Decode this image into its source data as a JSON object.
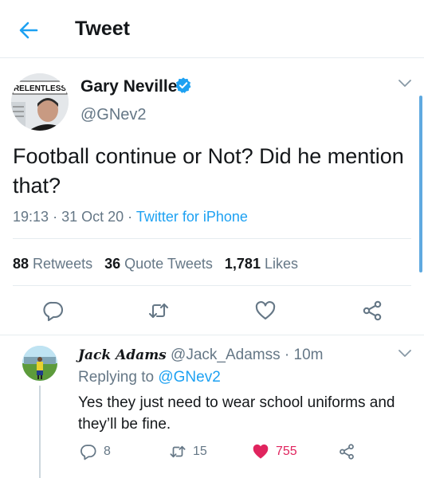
{
  "header": {
    "title": "Tweet"
  },
  "tweet": {
    "author_name": "Gary Neville",
    "author_handle": "@GNev2",
    "avatar_text": "RELENTLESS",
    "text": "Football continue or Not? Did he mention that?",
    "time": "19:13",
    "date": "31 Oct 20",
    "separator": "·",
    "app": "Twitter for iPhone",
    "stats": {
      "retweets_count": "88",
      "retweets_label": "Retweets",
      "quotes_count": "36",
      "quotes_label": "Quote Tweets",
      "likes_count": "1,781",
      "likes_label": "Likes"
    }
  },
  "reply": {
    "author_name": "Jack Adams",
    "author_handle": "@Jack_Adamss",
    "separator": "·",
    "time": "10m",
    "replying_prefix": "Replying to",
    "replying_to": "@GNev2",
    "text": "Yes they just need to wear school uniforms and they’ll be fine.",
    "actions": {
      "replies": "8",
      "retweets": "15",
      "likes": "755"
    }
  },
  "colors": {
    "accent": "#1da1f2",
    "like": "#e0245e",
    "muted": "#657786",
    "text": "#14171a"
  },
  "icons": [
    "back-arrow-icon",
    "verified-badge-icon",
    "chevron-down-icon",
    "reply-icon",
    "retweet-icon",
    "like-icon",
    "share-icon"
  ]
}
